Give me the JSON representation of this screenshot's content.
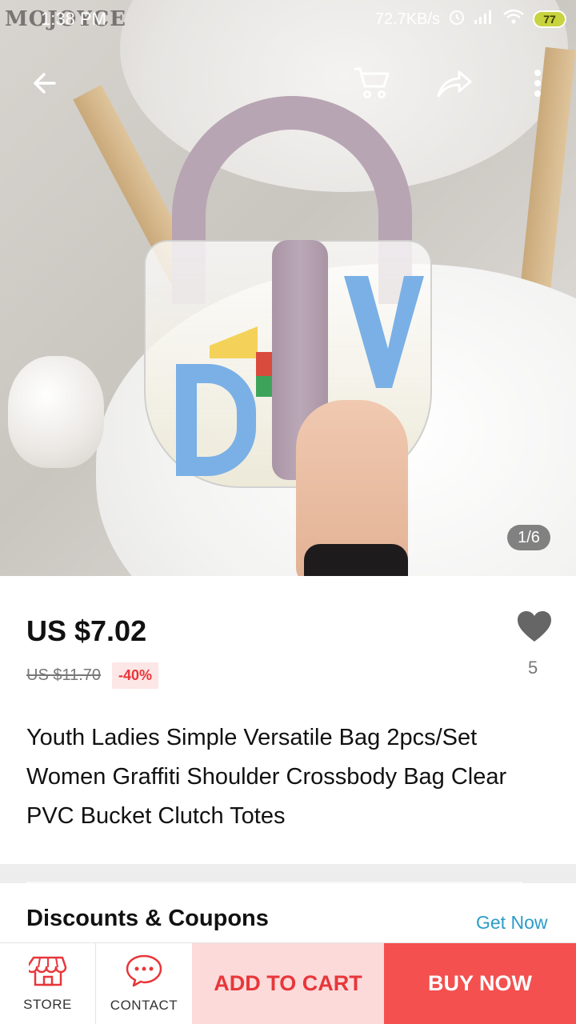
{
  "status_bar": {
    "watermark": "MOJOYCE",
    "time": "1:38 PM",
    "net_speed": "72.7KB/s",
    "battery": "77",
    "icons": [
      "alarm-icon",
      "signal-icon",
      "wifi-icon",
      "battery-icon"
    ]
  },
  "top_actions": {
    "icons": [
      "back-arrow-icon",
      "cart-icon",
      "share-icon",
      "more-vertical-icon"
    ]
  },
  "gallery": {
    "counter": "1/6"
  },
  "product": {
    "price": "US $7.02",
    "original_price": "US $11.70",
    "discount": "-40%",
    "wishlist_count": "5",
    "title": "Youth Ladies Simple Versatile Bag 2pcs/Set Women Graffiti Shoulder Crossbody Bag Clear PVC Bucket Clutch Totes"
  },
  "discounts": {
    "title": "Discounts & Coupons",
    "action": "Get Now"
  },
  "bottom_bar": {
    "store_label": "STORE",
    "contact_label": "CONTACT",
    "add_to_cart": "ADD TO CART",
    "buy_now": "BUY NOW"
  },
  "colors": {
    "accent_red": "#f45050",
    "cart_bg": "#fcdada",
    "discount_text": "#e8363a",
    "link_blue": "#2d9cc9"
  }
}
